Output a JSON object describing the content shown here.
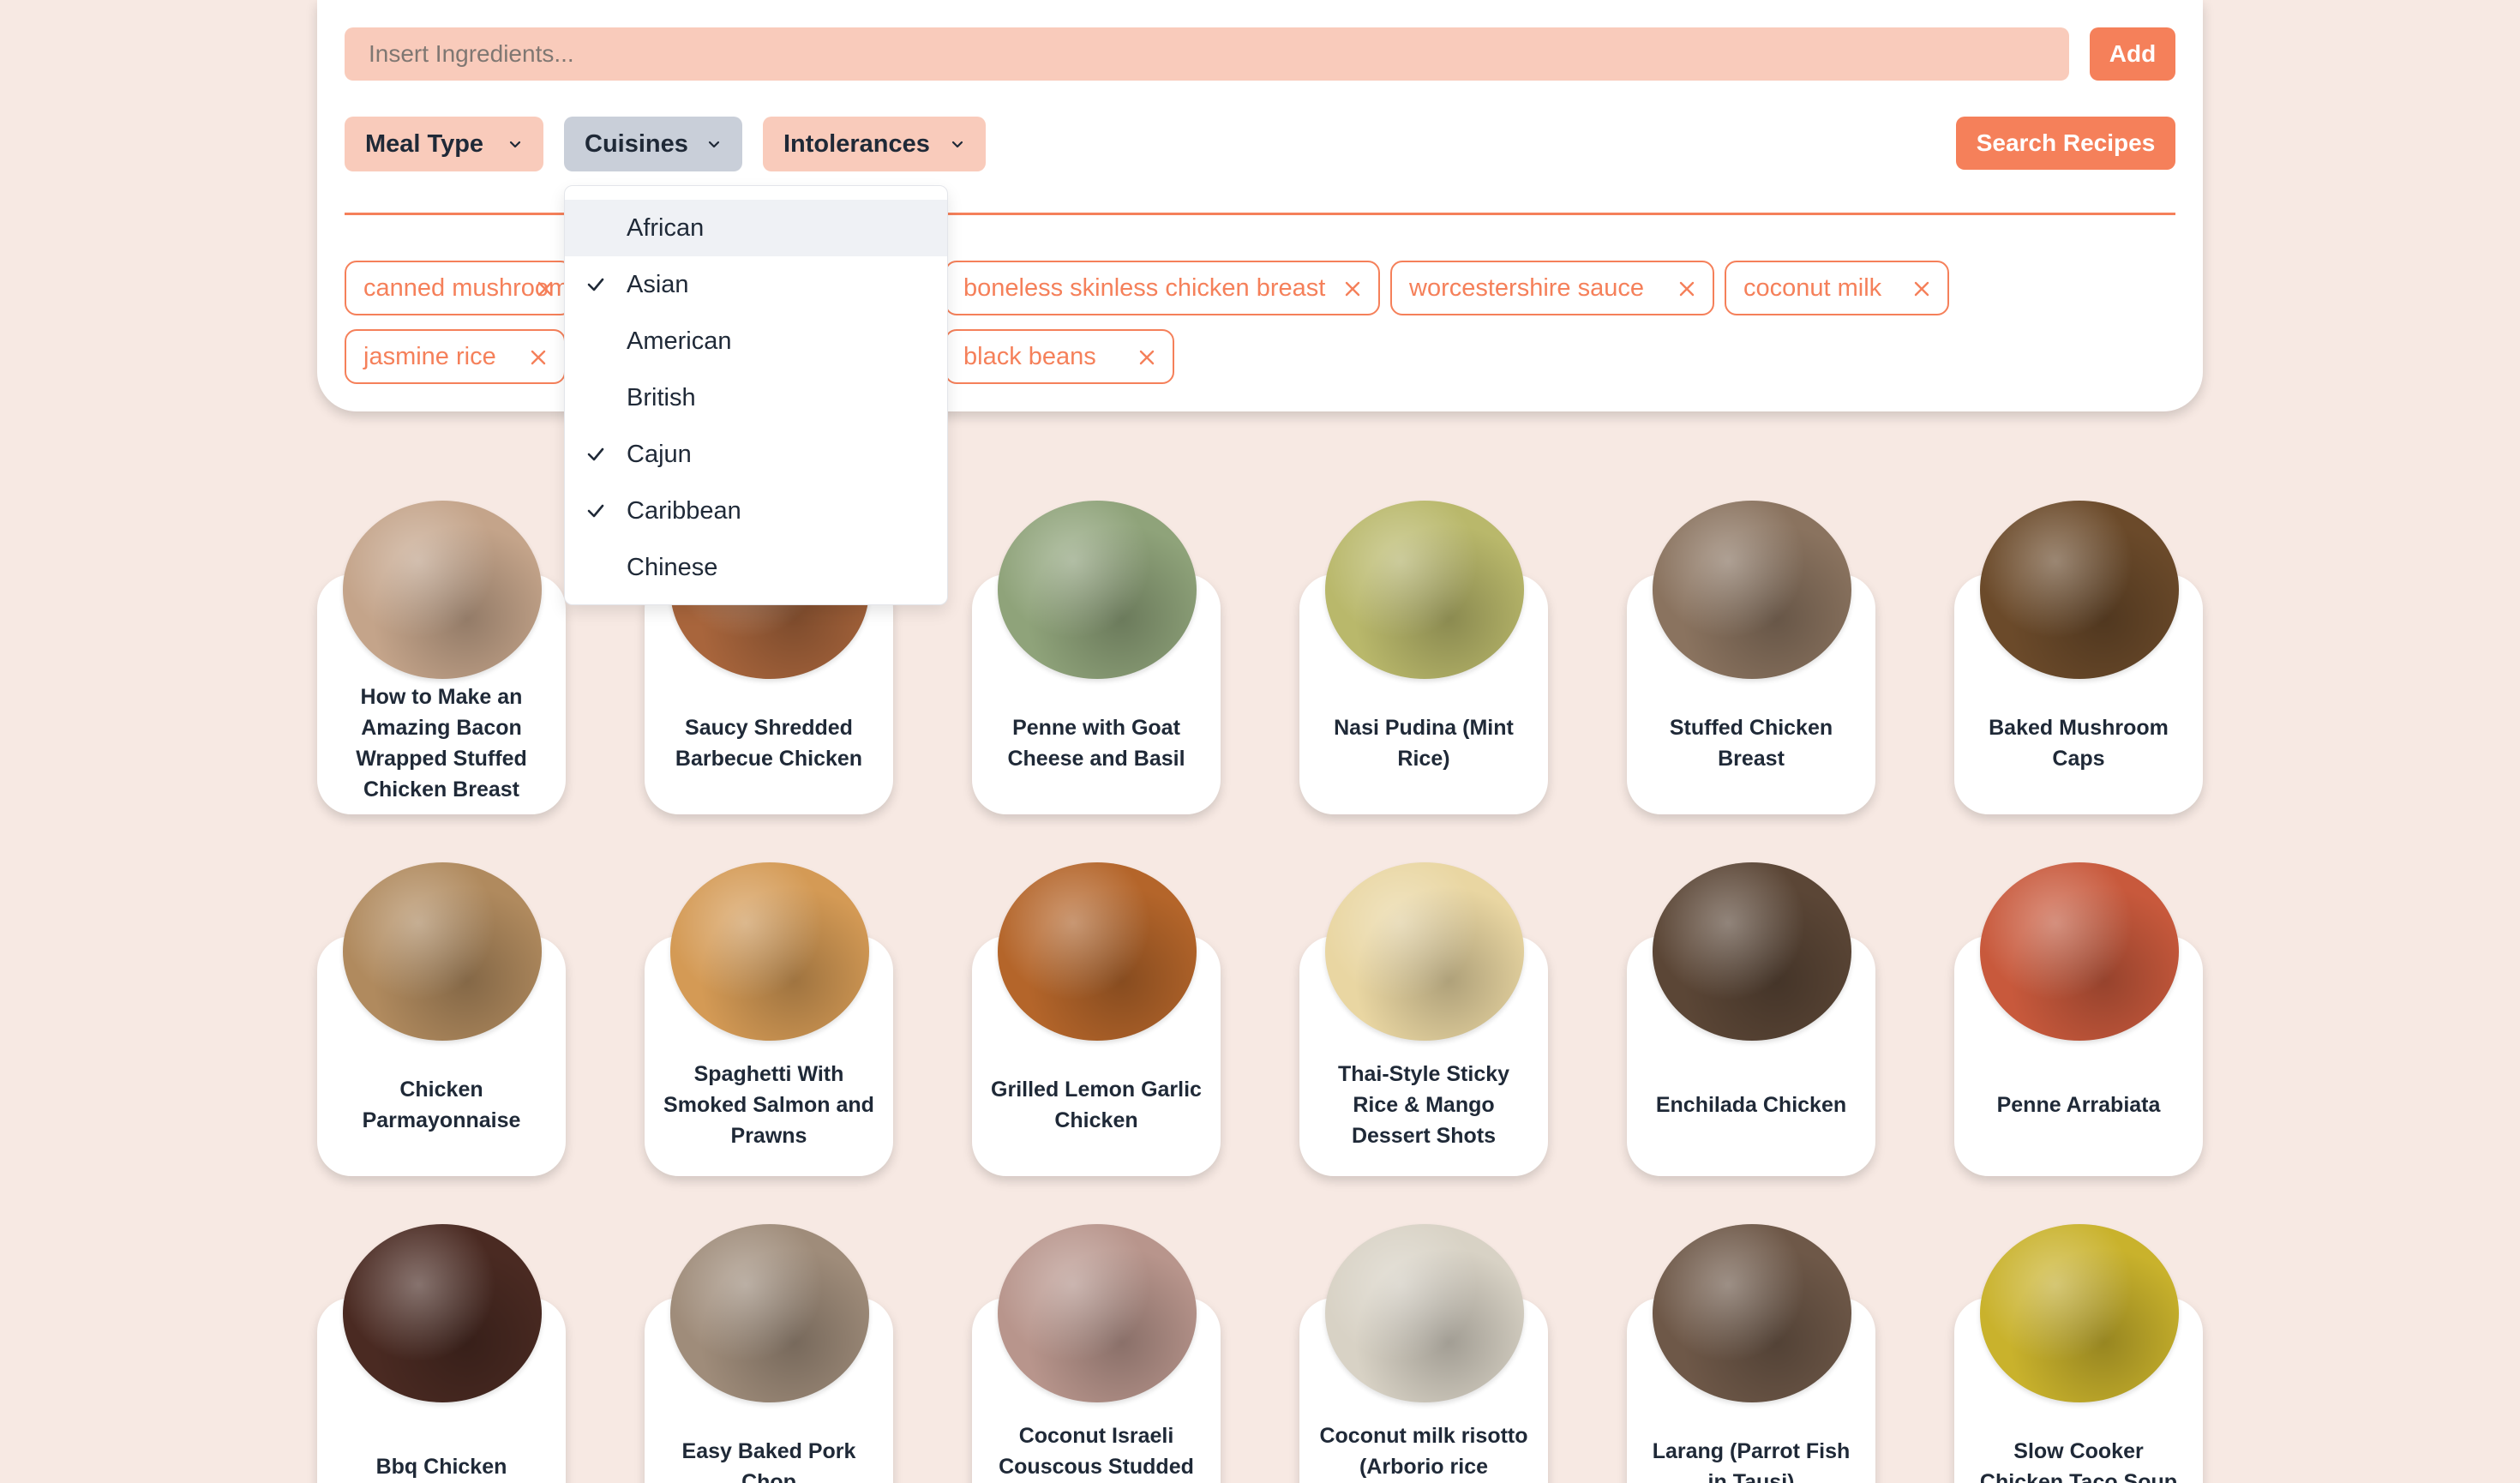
{
  "search": {
    "placeholder": "Insert Ingredients...",
    "add_label": "Add"
  },
  "filters": {
    "meal_type": "Meal Type",
    "cuisines": "Cuisines",
    "intolerances": "Intolerances",
    "search_label": "Search Recipes"
  },
  "ingredients": [
    "canned mushrooms",
    "boneless skinless chicken breast",
    "worcestershire sauce",
    "coconut milk",
    "jasmine rice",
    "black beans"
  ],
  "cuisine_menu": {
    "highlighted": "African",
    "items": [
      {
        "label": "African",
        "checked": false
      },
      {
        "label": "Asian",
        "checked": true
      },
      {
        "label": "American",
        "checked": false
      },
      {
        "label": "British",
        "checked": false
      },
      {
        "label": "Cajun",
        "checked": true
      },
      {
        "label": "Caribbean",
        "checked": true
      },
      {
        "label": "Chinese",
        "checked": false
      }
    ]
  },
  "recipes": [
    {
      "title": "How to Make an Amazing Bacon Wrapped Stuffed Chicken Breast",
      "color": "#c4a48a"
    },
    {
      "title": "Saucy Shredded Barbecue Chicken",
      "color": "#a8653c"
    },
    {
      "title": "Penne with Goat Cheese and Basil",
      "color": "#8fa37a"
    },
    {
      "title": "Nasi Pudina (Mint Rice)",
      "color": "#b9b86b"
    },
    {
      "title": "Stuffed Chicken Breast",
      "color": "#8a735f"
    },
    {
      "title": "Baked Mushroom Caps",
      "color": "#6b4a2a"
    },
    {
      "title": "Chicken Parmayonnaise",
      "color": "#b08a5e"
    },
    {
      "title": "Spaghetti With Smoked Salmon and Prawns",
      "color": "#d49a55"
    },
    {
      "title": "Grilled Lemon Garlic Chicken",
      "color": "#b4652a"
    },
    {
      "title": "Thai-Style Sticky Rice & Mango Dessert Shots",
      "color": "#e9d6a2"
    },
    {
      "title": "Enchilada Chicken",
      "color": "#5b4636"
    },
    {
      "title": "Penne Arrabiata",
      "color": "#c8593c"
    },
    {
      "title": "Bbq Chicken",
      "color": "#4a2a22"
    },
    {
      "title": "Easy Baked Pork Chop",
      "color": "#9f8c7a"
    },
    {
      "title": "Coconut Israeli Couscous Studded With Pomegranate",
      "color": "#b8958c"
    },
    {
      "title": "Coconut milk risotto (Arborio rice pudding)",
      "color": "#d8d2c5"
    },
    {
      "title": "Larang (Parrot Fish in Tausi)",
      "color": "#6e5848"
    },
    {
      "title": "Slow Cooker Chicken Taco Soup",
      "color": "#c9b22c"
    }
  ],
  "colors": {
    "accent": "#f5805a",
    "background": "#f7e9e3",
    "input_fill": "#f9cbbb",
    "active_filter": "#c9cfd9"
  },
  "icons": {
    "chevron": "chevron-down-icon",
    "remove": "close-icon",
    "check": "check-icon"
  }
}
